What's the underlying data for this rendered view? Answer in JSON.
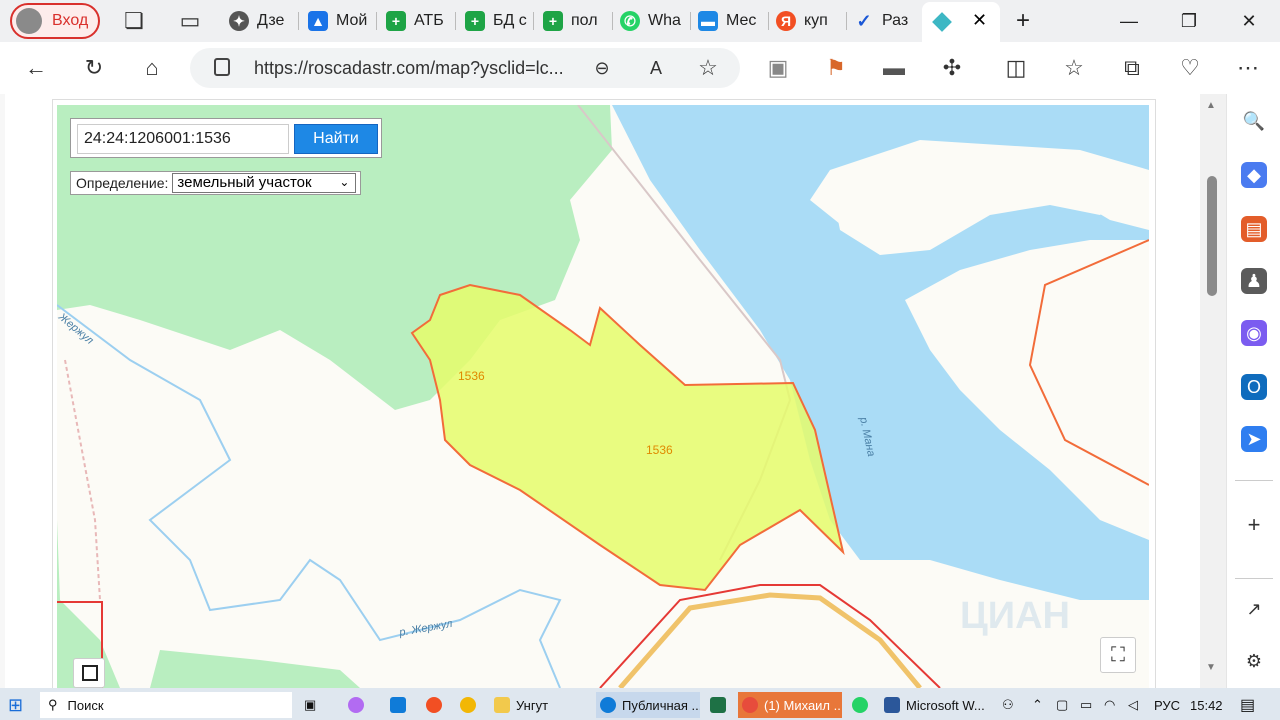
{
  "browser": {
    "profile_label": "Вход",
    "tabs": [
      {
        "label": "Дзе",
        "color": "#555555"
      },
      {
        "label": "Мой",
        "color": "#1a73e8"
      },
      {
        "label": "АТБ",
        "color": "#1ea446"
      },
      {
        "label": "БД с",
        "color": "#1ea446"
      },
      {
        "label": "пол",
        "color": "#1ea446"
      },
      {
        "label": "Wha",
        "color": "#25d366"
      },
      {
        "label": "Мес",
        "color": "#1e88e5"
      },
      {
        "label": "куп",
        "color": "#f24f23"
      },
      {
        "label": "Раз",
        "color": "#1a57d6"
      }
    ],
    "address": "https://roscadastr.com/map?ysclid=lc..."
  },
  "map": {
    "search_value": "24:24:1206001:1536",
    "search_button": "Найти",
    "definition_label": "Определение:",
    "definition_value": "земельный участок",
    "parcel_label_1": "1536",
    "parcel_label_2": "1536",
    "river_mana": "р. Мана",
    "river_zherzhul_1": "р. Жержул",
    "river_zherzhul_2": "Жержул",
    "watermark": "ЦИАН"
  },
  "taskbar": {
    "search": "Поиск",
    "items": [
      {
        "label": "Унгут",
        "color": "#f2c94c"
      },
      {
        "label": "Публичная ...",
        "color": "#0f7bd8"
      },
      {
        "label": "",
        "color": "#1e7145"
      },
      {
        "label": "(1) Михаил ...",
        "color": "#e74c3c"
      },
      {
        "label": "",
        "color": "#25d366"
      },
      {
        "label": "Microsoft W...",
        "color": "#2b579a"
      }
    ],
    "lang": "РУС",
    "time": "15:42"
  },
  "colors": {
    "forest": "#b9eec0",
    "water": "#aadcf6",
    "parcel_fill": "#e5fb6b",
    "parcel_stroke": "#f26c3a",
    "accent": "#1e88e5"
  }
}
